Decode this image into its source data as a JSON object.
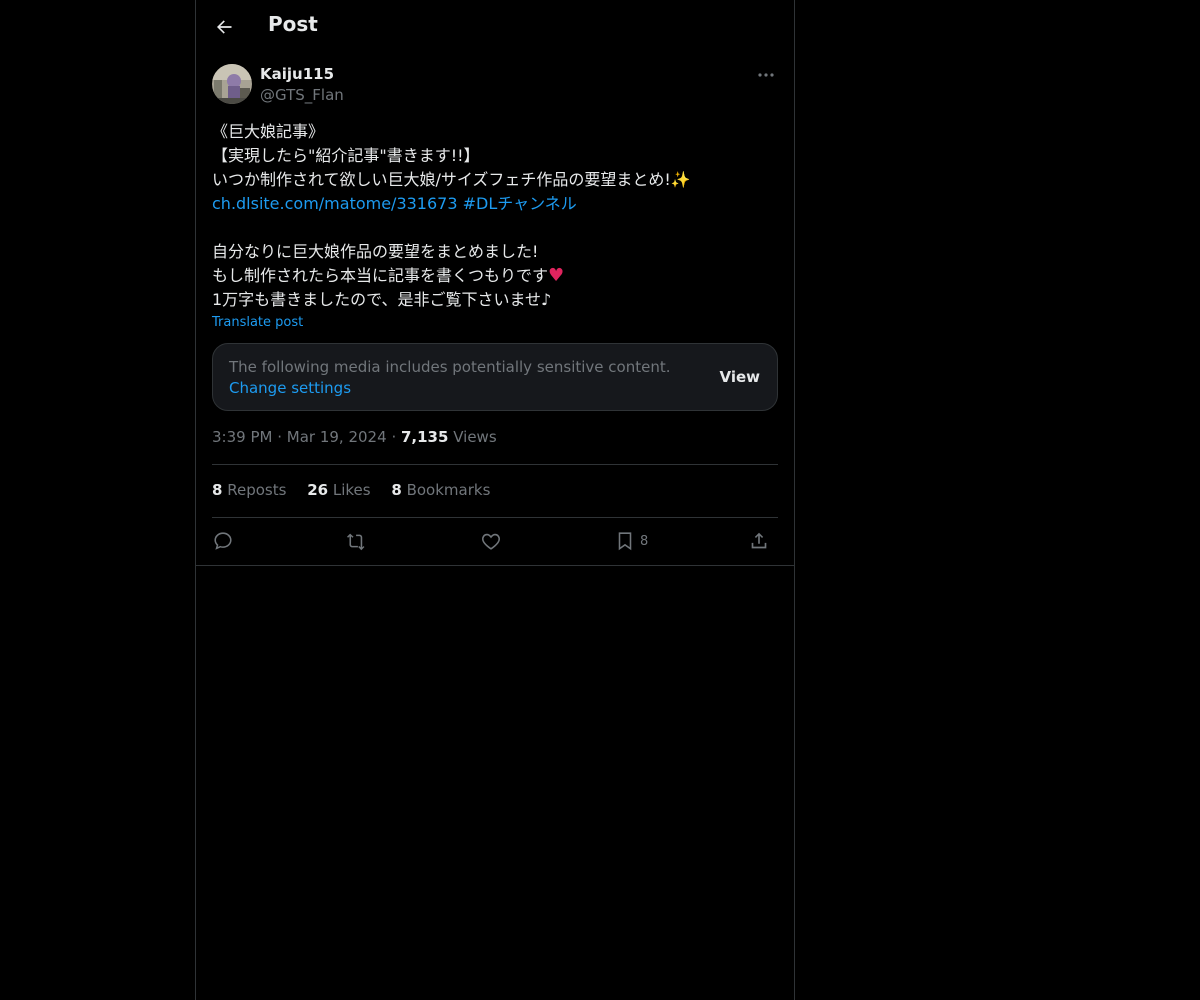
{
  "header": {
    "title": "Post",
    "back_icon": "arrow-left-icon"
  },
  "author": {
    "display_name": "Kaiju115",
    "handle": "@GTS_Flan"
  },
  "tweet": {
    "lines": [
      "《巨大娘記事》",
      "【実現したら\"紹介記事\"書きます!!】",
      "いつか制作されて欲しい巨大娘/サイズフェチ作品の要望まとめ!✨"
    ],
    "link_url": "ch.dlsite.com/matome/331673",
    "hashtag": "#DLチャンネル",
    "lines2": [
      "自分なりに巨大娘作品の要望をまとめました!",
      "もし制作されたら本当に記事を書くつもりです",
      "1万字も書きましたので、是非ご覧下さいませ♪"
    ],
    "heart_emoji": "♥",
    "translate_label": "Translate post"
  },
  "sensitive": {
    "text": "The following media includes potentially sensitive content.",
    "link": "Change settings",
    "view_label": "View"
  },
  "meta": {
    "time": "3:39 PM",
    "date": "Mar 19, 2024",
    "views_count": "7,135",
    "views_label": "Views"
  },
  "stats": {
    "reposts_count": "8",
    "reposts_label": "Reposts",
    "likes_count": "26",
    "likes_label": "Likes",
    "bookmarks_count": "8",
    "bookmarks_label": "Bookmarks"
  },
  "actions": {
    "bookmark_count": "8"
  },
  "colors": {
    "background": "#000000",
    "text": "#e7e9ea",
    "muted": "#71767b",
    "accent": "#1d9bf0",
    "border": "#2f3336",
    "heart": "#e0245e"
  }
}
